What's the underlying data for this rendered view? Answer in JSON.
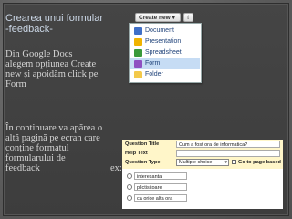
{
  "slide": {
    "title_line1": "Crearea unui formular",
    "title_line2": "-feedback-",
    "text1_line1": "Din Google Docs",
    "text1_line2": "alegem opțiunea Create",
    "text1_line3": "new și apoidăm click pe",
    "text1_line4": "Form",
    "text2_line1": "În continuare va apărea o",
    "text2_line2": "altă pagină pe ecran care",
    "text2_line3": "conține formatul",
    "text2_line4": "formularului de",
    "text2_line5": "feedback",
    "ex_label": "ex:"
  },
  "create_menu": {
    "button_label": "Create new",
    "button_arrow": "▾",
    "upload_arrow": "⇧",
    "items": [
      {
        "label": "Document",
        "icon": "document-icon"
      },
      {
        "label": "Presentation",
        "icon": "presentation-icon"
      },
      {
        "label": "Spreadsheet",
        "icon": "spreadsheet-icon"
      },
      {
        "label": "Form",
        "icon": "form-icon",
        "selected": true
      },
      {
        "label": "Folder",
        "icon": "folder-icon"
      }
    ]
  },
  "question_form": {
    "question_title_label": "Question Title",
    "question_title_value": "Cum a fost ora de informatica?",
    "help_text_label": "Help Text",
    "question_type_label": "Question Type",
    "question_type_value": "Multiple choice",
    "page_based_label": "Go to page based",
    "options": [
      "interesanta",
      "plictisitoare",
      "ca orice alta ora"
    ],
    "colors": {
      "header_bg": "#fff6c9"
    }
  }
}
